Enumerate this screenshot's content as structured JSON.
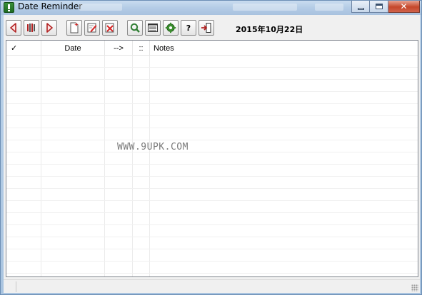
{
  "window": {
    "title": "Date Reminder",
    "caption_buttons": {
      "minimize": "minimize",
      "maximize": "maximize",
      "close": "✕"
    }
  },
  "toolbar": {
    "buttons": [
      {
        "name": "previous-day",
        "icon": "arrow-left-icon"
      },
      {
        "name": "today",
        "icon": "calendar-bars-icon"
      },
      {
        "name": "next-day",
        "icon": "arrow-right-icon"
      },
      {
        "name": "new-reminder",
        "icon": "new-document-icon"
      },
      {
        "name": "edit-reminder",
        "icon": "edit-document-icon"
      },
      {
        "name": "delete-reminder",
        "icon": "delete-document-icon"
      },
      {
        "name": "search",
        "icon": "search-icon"
      },
      {
        "name": "list-view",
        "icon": "list-icon"
      },
      {
        "name": "settings",
        "icon": "gear-icon"
      },
      {
        "name": "help",
        "icon": "help-icon",
        "label": "?"
      },
      {
        "name": "exit",
        "icon": "exit-icon"
      }
    ],
    "current_date": "2015年10月22日"
  },
  "list": {
    "columns": [
      "✓",
      "Date",
      "-->",
      "::",
      "Notes"
    ],
    "rows": []
  },
  "watermark": "WWW.9UPK.COM",
  "colors": {
    "titlebar": "#b4cce6",
    "close_button": "#c5472b",
    "arrow_red": "#b22222",
    "search_green": "#2e7d32",
    "gear_green": "#3c8f2f"
  }
}
